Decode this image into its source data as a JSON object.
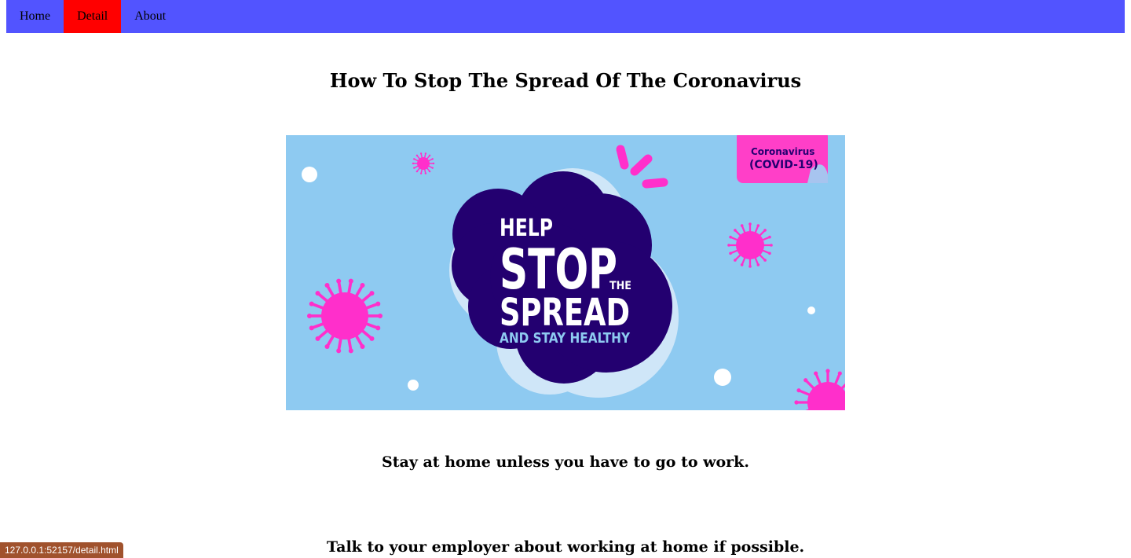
{
  "nav": {
    "items": [
      {
        "label": "Home"
      },
      {
        "label": "Detail",
        "active": true
      },
      {
        "label": "About"
      }
    ],
    "bar_color": "#5254ff",
    "active_color": "#ff0000"
  },
  "page": {
    "title": "How To Stop The Spread Of The Coronavirus",
    "paragraphs": [
      "Stay at home unless you have to go to work.",
      "Talk to your employer about working at home if possible."
    ]
  },
  "hero_image": {
    "tag_line1": "Coronavirus",
    "tag_line2": "(COVID-19)",
    "help": "HELP",
    "stop": "STOP",
    "the": "THE",
    "spread": "SPREAD",
    "healthy": "AND STAY HEALTHY",
    "bg_color": "#8ecaf1",
    "cloud_color": "#230070",
    "virus_color": "#ff2fcb"
  },
  "status": {
    "url": "127.0.0.1:52157/detail.html"
  }
}
